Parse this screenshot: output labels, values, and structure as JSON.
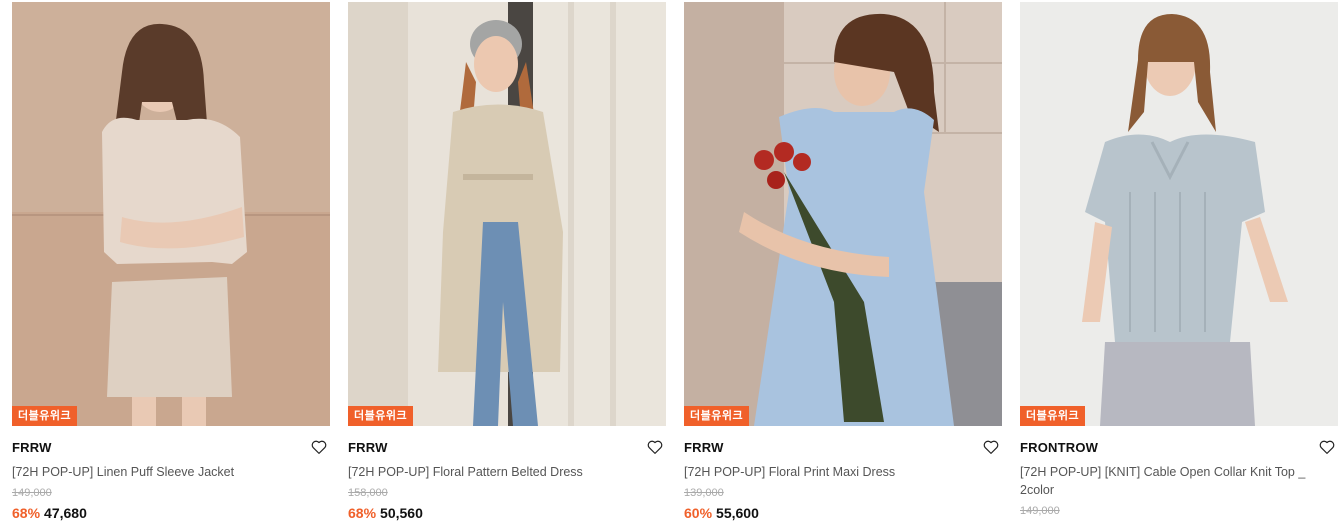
{
  "products": [
    {
      "badge": "더블유위크",
      "brand": "FRRW",
      "name": "[72H POP-UP] Linen Puff Sleeve Jacket",
      "original_price": "149,000",
      "discount": "68%",
      "sale_price": "47,680",
      "image_icon": "photo-model-linen-jacket",
      "colors": {
        "bg": "#c9a78f",
        "garment": "#e6d8cc",
        "hair": "#5a3b2a"
      }
    },
    {
      "badge": "더블유위크",
      "brand": "FRRW",
      "name": "[72H POP-UP] Floral Pattern Belted Dress",
      "original_price": "158,000",
      "discount": "68%",
      "sale_price": "50,560",
      "image_icon": "photo-model-belted-dress",
      "colors": {
        "bg": "#e8e2d9",
        "garment": "#d8cbb4",
        "hair": "#b06a3c"
      }
    },
    {
      "badge": "더블유위크",
      "brand": "FRRW",
      "name": "[72H POP-UP] Floral Print Maxi Dress",
      "original_price": "139,000",
      "discount": "60%",
      "sale_price": "55,600",
      "image_icon": "photo-model-maxi-dress",
      "colors": {
        "bg": "#c4b0a2",
        "garment": "#a9c3df",
        "hair": "#5b3622"
      }
    },
    {
      "badge": "더블유위크",
      "brand": "FRONTROW",
      "name": "[72H POP-UP] [KNIT] Cable Open Collar Knit Top _ 2color",
      "original_price": "149,000",
      "discount": "",
      "sale_price": "",
      "image_icon": "photo-model-knit-top",
      "colors": {
        "bg": "#ececea",
        "garment": "#b8c4cc",
        "hair": "#8a5a36"
      }
    }
  ],
  "accent_color": "#f0602a"
}
